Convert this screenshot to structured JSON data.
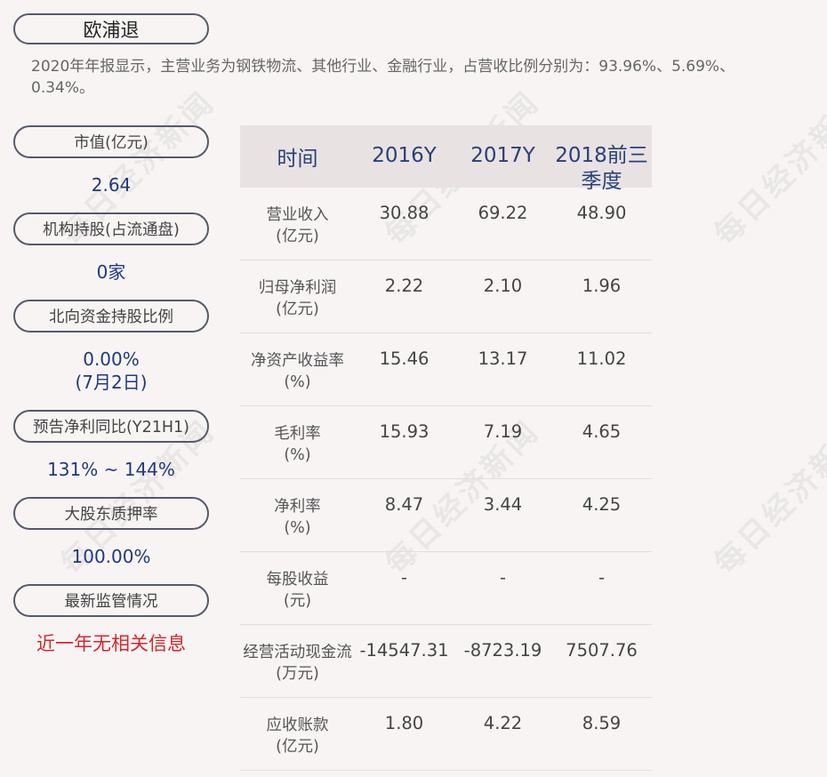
{
  "title": "欧浦退",
  "description": "2020年年报显示，主营业务为钢铁物流、其他行业、金融行业，占营收比例分别为：93.96%、5.69%、0.34%。",
  "left_panel": [
    {
      "label": "市值(亿元)",
      "value": "2.64"
    },
    {
      "label": "机构持股(占流通盘)",
      "value": "0家"
    },
    {
      "label": "北向资金持股比例",
      "value": "0.00%",
      "value2": "(7月2日)"
    },
    {
      "label": "预告净利同比(Y21H1)",
      "value": "131% ~ 144%"
    },
    {
      "label": "大股东质押率",
      "value": "100.00%"
    },
    {
      "label": "最新监管情况",
      "value": "近一年无相关信息"
    }
  ],
  "table": {
    "header": {
      "time": "时间",
      "cols": [
        "2016Y",
        "2017Y",
        "2018前三季度"
      ]
    },
    "rows": [
      {
        "label": "营业收入",
        "unit": "(亿元)",
        "values": [
          "30.88",
          "69.22",
          "48.90"
        ]
      },
      {
        "label": "归母净利润",
        "unit": "(亿元)",
        "values": [
          "2.22",
          "2.10",
          "1.96"
        ]
      },
      {
        "label": "净资产收益率",
        "unit": "(%)",
        "values": [
          "15.46",
          "13.17",
          "11.02"
        ]
      },
      {
        "label": "毛利率",
        "unit": "(%)",
        "values": [
          "15.93",
          "7.19",
          "4.65"
        ]
      },
      {
        "label": "净利率",
        "unit": "(%)",
        "values": [
          "8.47",
          "3.44",
          "4.25"
        ]
      },
      {
        "label": "每股收益",
        "unit": "(元)",
        "values": [
          "-",
          "-",
          "-"
        ]
      },
      {
        "label": "经营活动现金流",
        "unit": "(万元)",
        "values": [
          "-14547.31",
          "-8723.19",
          "7507.76"
        ]
      },
      {
        "label": "应收账款",
        "unit": "(亿元)",
        "values": [
          "1.80",
          "4.22",
          "8.59"
        ]
      }
    ]
  },
  "watermark": "每日经济新闻",
  "colors": {
    "background": "#f8f4f4",
    "value_blue": "#1f3b7a",
    "alert_red": "#d6262a",
    "header_bg": "#e9e2e3"
  }
}
